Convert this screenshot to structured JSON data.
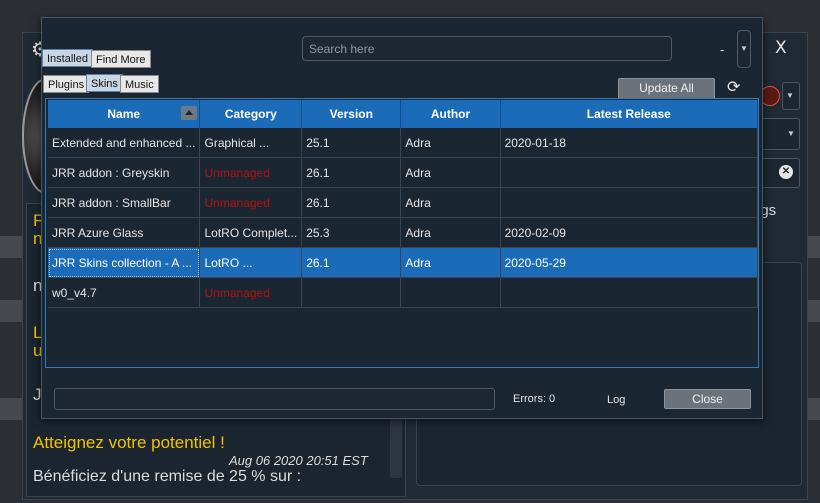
{
  "background": {
    "close_label": "X",
    "letter_f": "F",
    "letter_n1": "n",
    "letter_n2": "n",
    "letter_l": "L",
    "letter_u": "u",
    "letter_j": "J",
    "ngs_text": "ngs",
    "news": {
      "title": "Atteignez votre potentiel !",
      "date": "Aug 06 2020 20:51 EST",
      "body": "Bénéficiez d'une remise de 25 % sur :"
    }
  },
  "manager": {
    "tabs_top": [
      {
        "label": "Installed",
        "active": true
      },
      {
        "label": "Find More",
        "active": false
      }
    ],
    "tabs_sub": [
      {
        "label": "Plugins",
        "active": false
      },
      {
        "label": "Skins",
        "active": true
      },
      {
        "label": "Music",
        "active": false
      }
    ],
    "search": {
      "placeholder": "Search here"
    },
    "dash": "-",
    "update_all": "Update All",
    "columns": [
      "Name",
      "Category",
      "Version",
      "Author",
      "Latest Release"
    ],
    "rows": [
      {
        "name": "Extended and enhanced ...",
        "category": "Graphical ...",
        "version": "25.1",
        "author": "Adra",
        "latest": "2020-01-18",
        "unmanaged": false,
        "selected": false
      },
      {
        "name": "JRR addon : Greyskin",
        "category": "Unmanaged",
        "version": "26.1",
        "author": "Adra",
        "latest": "",
        "unmanaged": true,
        "selected": false
      },
      {
        "name": "JRR addon : SmallBar",
        "category": "Unmanaged",
        "version": "26.1",
        "author": "Adra",
        "latest": "",
        "unmanaged": true,
        "selected": false
      },
      {
        "name": "JRR Azure Glass",
        "category": "LotRO Complet...",
        "version": "25.3",
        "author": "Adra",
        "latest": "2020-02-09",
        "unmanaged": false,
        "selected": false
      },
      {
        "name": "JRR Skins collection - A ...",
        "category": "LotRO ...",
        "version": "26.1",
        "author": "Adra",
        "latest": "2020-05-29",
        "unmanaged": false,
        "selected": true
      },
      {
        "name": "w0_v4.7",
        "category": "Unmanaged",
        "version": "",
        "author": "",
        "latest": "",
        "unmanaged": true,
        "selected": false
      }
    ],
    "errors": "Errors: 0",
    "log": "Log",
    "close": "Close"
  },
  "colors": {
    "header_blue": "#1c6bb8",
    "unmanaged_red": "#b31010",
    "news_yellow": "#f2c200"
  },
  "icons": [
    "gear-icon",
    "close-icon",
    "refresh-icon",
    "chevron-down-icon",
    "sort-arrow-icon",
    "clear-icon"
  ]
}
